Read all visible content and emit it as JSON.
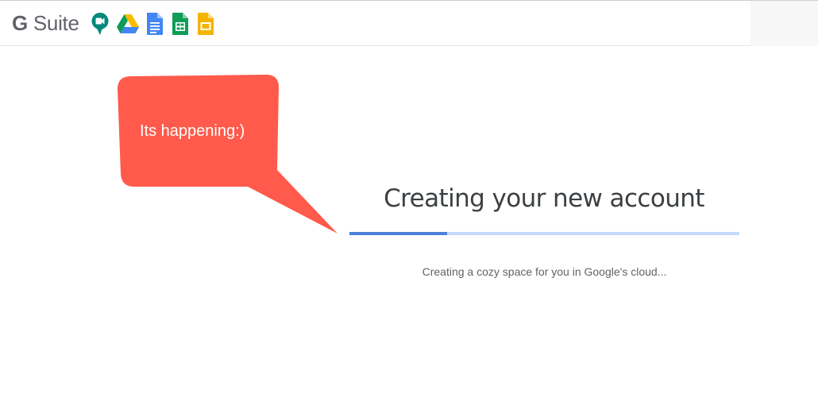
{
  "header": {
    "brand_prefix": "G",
    "brand_suffix": " Suite",
    "apps": [
      {
        "name": "meet-icon",
        "color": "#00897b"
      },
      {
        "name": "drive-icon",
        "color": "#1e88e5"
      },
      {
        "name": "docs-icon",
        "color": "#4285f4"
      },
      {
        "name": "sheets-icon",
        "color": "#0f9d58"
      },
      {
        "name": "slides-icon",
        "color": "#f4b400"
      }
    ]
  },
  "callout": {
    "text": "Its happening:)",
    "color": "#ff5a4b"
  },
  "main": {
    "title": "Creating your new account",
    "progress_percent": 25,
    "progress_color": "#4a7fdc",
    "track_color": "#c6dafc",
    "subtitle": "Creating a cozy space for you in Google's cloud..."
  }
}
